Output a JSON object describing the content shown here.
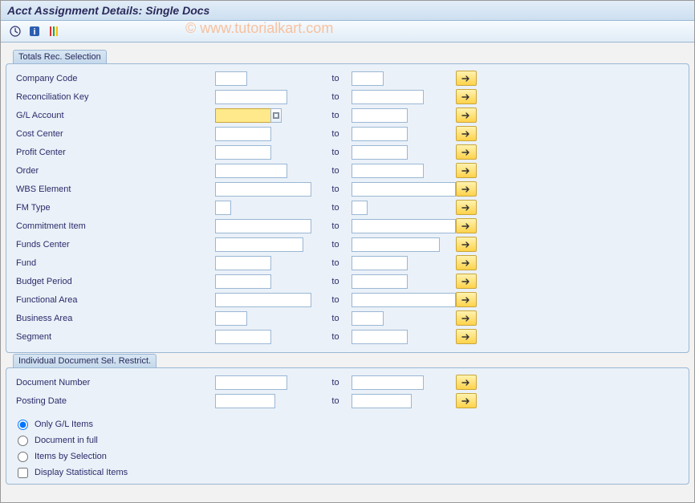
{
  "window": {
    "title": "Acct Assignment Details: Single Docs"
  },
  "watermark": "© www.tutorialkart.com",
  "toolbar": {
    "execute_icon": "execute-clock-icon",
    "info_icon": "info-icon",
    "variant_icon": "variant-icon"
  },
  "common": {
    "to_label": "to"
  },
  "group1": {
    "title": "Totals Rec. Selection",
    "rows": [
      {
        "key": "company_code",
        "label": "Company Code",
        "fw": 40,
        "tw": 40
      },
      {
        "key": "reconciliation",
        "label": "Reconciliation Key",
        "fw": 90,
        "tw": 90
      },
      {
        "key": "gl_account",
        "label": "G/L Account",
        "fw": 70,
        "tw": 70,
        "focused": true
      },
      {
        "key": "cost_center",
        "label": "Cost Center",
        "fw": 70,
        "tw": 70
      },
      {
        "key": "profit_center",
        "label": "Profit Center",
        "fw": 70,
        "tw": 70
      },
      {
        "key": "order",
        "label": "Order",
        "fw": 90,
        "tw": 90
      },
      {
        "key": "wbs_element",
        "label": "WBS Element",
        "fw": 120,
        "tw": 130
      },
      {
        "key": "fm_type",
        "label": "FM Type",
        "fw": 20,
        "tw": 20
      },
      {
        "key": "commitment_item",
        "label": "Commitment Item",
        "fw": 120,
        "tw": 130
      },
      {
        "key": "funds_center",
        "label": "Funds Center",
        "fw": 110,
        "tw": 110
      },
      {
        "key": "fund",
        "label": "Fund",
        "fw": 70,
        "tw": 70
      },
      {
        "key": "budget_period",
        "label": "Budget Period",
        "fw": 70,
        "tw": 70
      },
      {
        "key": "functional_area",
        "label": "Functional Area",
        "fw": 120,
        "tw": 130
      },
      {
        "key": "business_area",
        "label": "Business Area",
        "fw": 40,
        "tw": 40
      },
      {
        "key": "segment",
        "label": "Segment",
        "fw": 70,
        "tw": 70
      }
    ]
  },
  "group2": {
    "title": "Individual Document Sel. Restrict.",
    "rows": [
      {
        "key": "doc_number",
        "label": "Document Number",
        "fw": 90,
        "tw": 90
      },
      {
        "key": "posting_date",
        "label": "Posting Date",
        "fw": 75,
        "tw": 75
      }
    ],
    "radios": [
      {
        "key": "only_gl",
        "label": "Only G/L Items",
        "checked": true
      },
      {
        "key": "doc_full",
        "label": "Document in full",
        "checked": false
      },
      {
        "key": "items_sel",
        "label": "Items by Selection",
        "checked": false
      }
    ],
    "checkbox": {
      "key": "disp_stat",
      "label": "Display Statistical Items",
      "checked": false
    }
  }
}
